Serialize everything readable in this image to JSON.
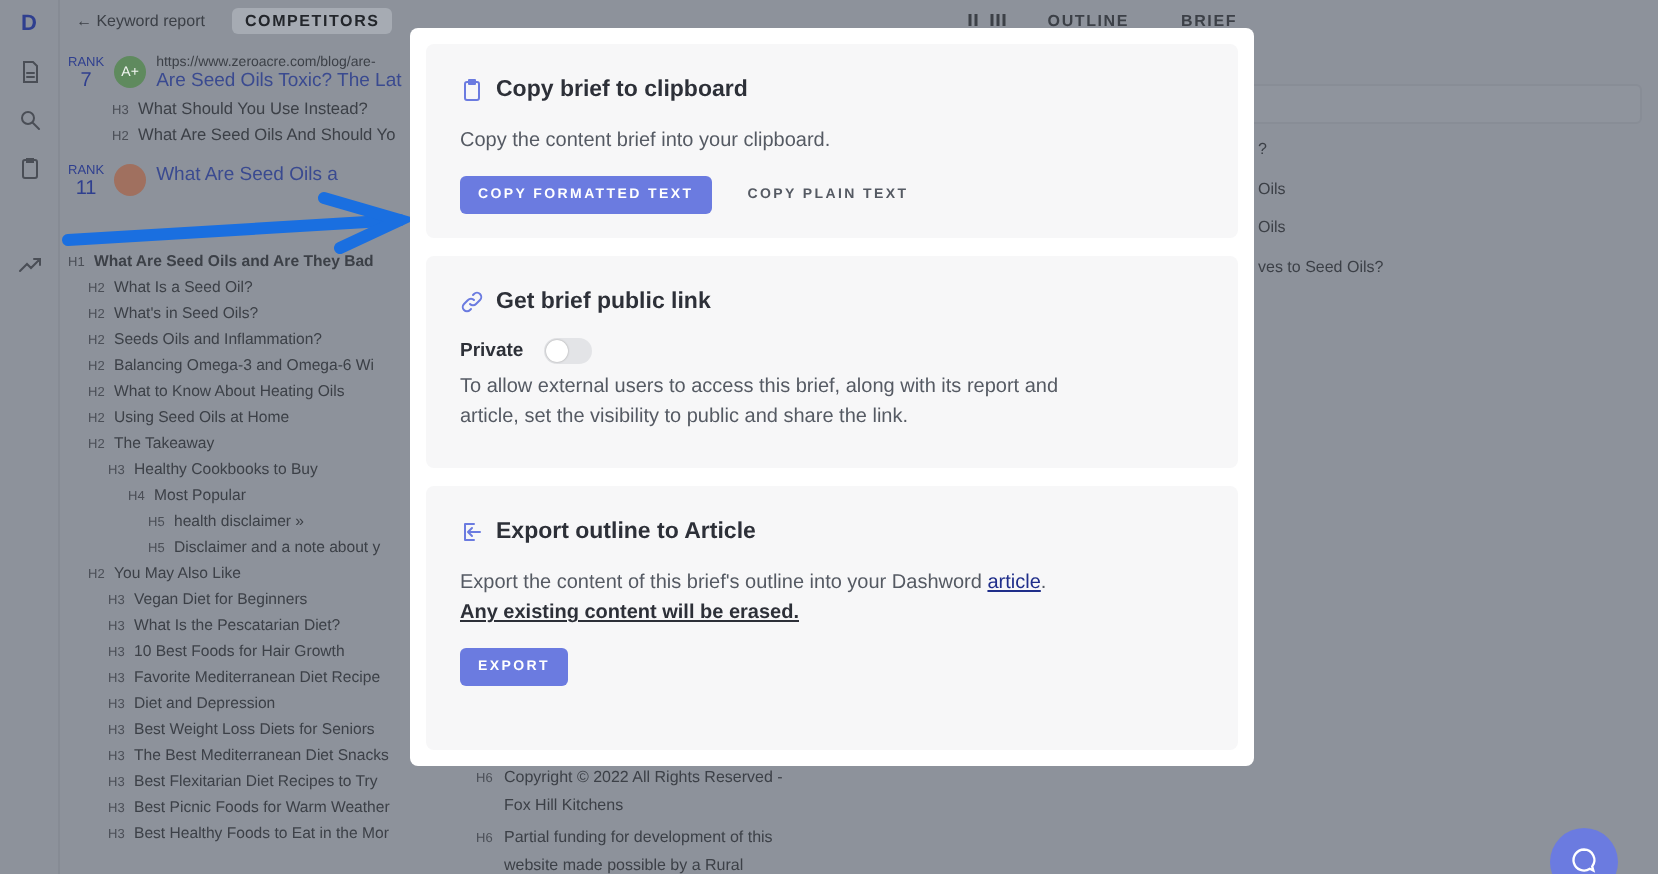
{
  "app": {
    "logo": "D",
    "back_link": "← Keyword report",
    "tabs": [
      {
        "label": "COMPETITORS",
        "selected": true
      },
      {
        "label": "OUTLINE",
        "selected": false
      },
      {
        "label": "BRIEF",
        "selected": false
      }
    ]
  },
  "competitors": [
    {
      "rank_label": "RANK",
      "rank": "7",
      "grade": "A+",
      "url": "https://www.zeroacre.com/blog/are-",
      "title": "Are Seed Oils Toxic? The Lat",
      "headings": [
        {
          "tag": "H3",
          "text": "What Should You Use Instead?"
        },
        {
          "tag": "H2",
          "text": "What Are Seed Oils And Should Yo"
        }
      ]
    },
    {
      "rank_label": "RANK",
      "rank": "11",
      "title": "What Are Seed Oils a"
    }
  ],
  "outline": [
    {
      "tag": "H1",
      "text": "What Are Seed Oils and Are They Bad",
      "children": [
        {
          "tag": "H2",
          "text": "What Is a Seed Oil?"
        },
        {
          "tag": "H2",
          "text": "What's in Seed Oils?"
        },
        {
          "tag": "H2",
          "text": "Seeds Oils and Inflammation?"
        },
        {
          "tag": "H2",
          "text": "Balancing Omega-3 and Omega-6 Wi"
        },
        {
          "tag": "H2",
          "text": "What to Know About Heating Oils"
        },
        {
          "tag": "H2",
          "text": "Using Seed Oils at Home"
        },
        {
          "tag": "H2",
          "text": "The Takeaway",
          "children": [
            {
              "tag": "H3",
              "text": "Healthy Cookbooks to Buy",
              "children": [
                {
                  "tag": "H4",
                  "text": "Most Popular",
                  "children": [
                    {
                      "tag": "H5",
                      "text": "health disclaimer »"
                    },
                    {
                      "tag": "H5",
                      "text": "Disclaimer and a note about y"
                    }
                  ]
                }
              ]
            }
          ]
        },
        {
          "tag": "H2",
          "text": "You May Also Like",
          "children": [
            {
              "tag": "H3",
              "text": "Vegan Diet for Beginners"
            },
            {
              "tag": "H3",
              "text": "What Is the Pescatarian Diet?"
            },
            {
              "tag": "H3",
              "text": "10 Best Foods for Hair Growth"
            },
            {
              "tag": "H3",
              "text": "Favorite Mediterranean Diet Recipe"
            },
            {
              "tag": "H3",
              "text": "Diet and Depression"
            },
            {
              "tag": "H3",
              "text": "Best Weight Loss Diets for Seniors"
            },
            {
              "tag": "H3",
              "text": "The Best Mediterranean Diet Snacks"
            },
            {
              "tag": "H3",
              "text": "Best Flexitarian Diet Recipes to Try"
            },
            {
              "tag": "H3",
              "text": "Best Picnic Foods for Warm Weather"
            },
            {
              "tag": "H3",
              "text": "Best Healthy Foods to Eat in the Mor"
            }
          ]
        }
      ]
    }
  ],
  "footer_headings": [
    {
      "tag": "H6",
      "text": "Copyright © 2022 All Rights Reserved - Fox Hill Kitchens"
    },
    {
      "tag": "H6",
      "text": "Partial funding for development of this website made possible by a Rural"
    }
  ],
  "right_panel": {
    "items": [
      "?",
      "Oils",
      "Oils",
      "ves to Seed Oils?"
    ]
  },
  "modal": {
    "copy_section": {
      "title": "Copy brief to clipboard",
      "text": "Copy the content brief into your clipboard.",
      "buttons": [
        {
          "label": "COPY FORMATTED TEXT",
          "kind": "primary"
        },
        {
          "label": "COPY PLAIN TEXT",
          "kind": "text"
        }
      ]
    },
    "link_section": {
      "title": "Get brief public link",
      "toggle": {
        "label": "Private",
        "on": false
      },
      "text": "To allow external users to access this brief, along with its report and article, set the visibility to public and share the link."
    },
    "export_section": {
      "title": "Export outline to Article",
      "text": "Export the content of this brief's outline into your Dashword ",
      "link": "article",
      "text_end": ".",
      "warning": "Any existing content will be erased.",
      "button": "EXPORT"
    }
  }
}
